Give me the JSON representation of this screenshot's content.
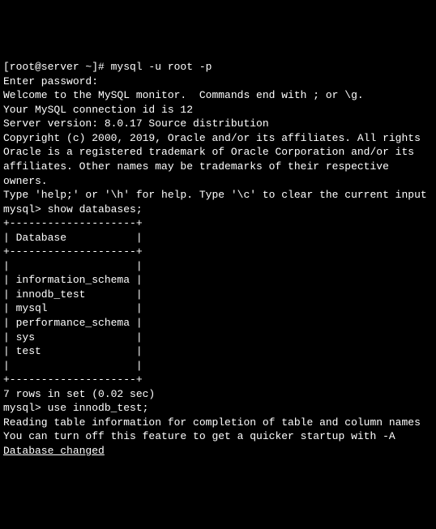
{
  "prompt_line": "[root@server ~]# mysql -u root -p",
  "enter_password": "Enter password:",
  "welcome": "Welcome to the MySQL monitor.  Commands end with ; or \\g.",
  "connection_id": "Your MySQL connection id is 12",
  "server_version": "Server version: 8.0.17 Source distribution",
  "blank": "",
  "copyright": "Copyright (c) 2000, 2019, Oracle and/or its affiliates. All rights",
  "trademark1": "Oracle is a registered trademark of Oracle Corporation and/or its",
  "trademark2": "affiliates. Other names may be trademarks of their respective",
  "trademark3": "owners.",
  "help_line": "Type 'help;' or '\\h' for help. Type '\\c' to clear the current input",
  "mysql_prompt1": "mysql> show databases;",
  "table_border": "+--------------------+",
  "table_header": "| Database           |",
  "db_row_blank": "|                    |",
  "db_row_info": "| information_schema |",
  "db_row_innodb": "| innodb_test        |",
  "db_row_mysql": "| mysql              |",
  "db_row_perf": "| performance_schema |",
  "db_row_sys": "| sys                |",
  "db_row_test": "| test               |",
  "rows_summary": "7 rows in set (0.02 sec)",
  "mysql_prompt2": "mysql> use innodb_test;",
  "reading_info": "Reading table information for completion of table and column names",
  "turnoff_info": "You can turn off this feature to get a quicker startup with -A",
  "db_changed": "Database changed"
}
